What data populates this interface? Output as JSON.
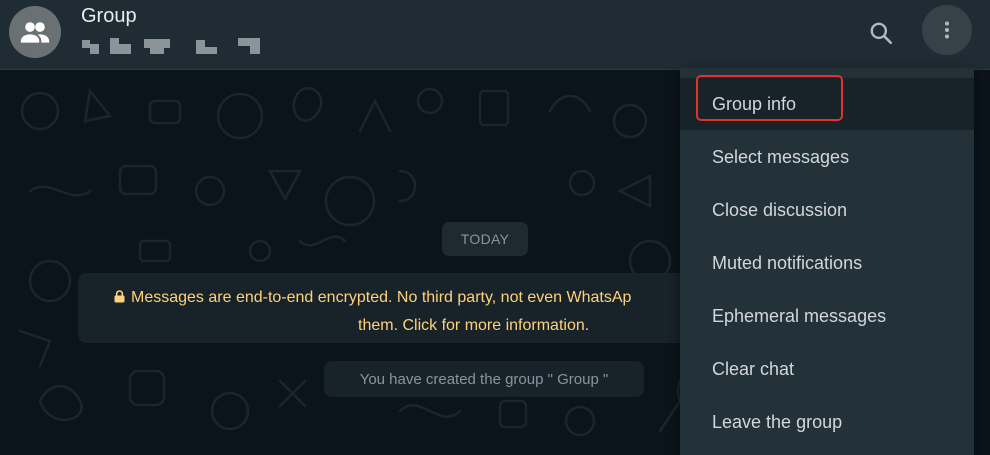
{
  "header": {
    "title": "Group",
    "avatar_icon": "group-icon",
    "search_icon": "search-icon",
    "menu_icon": "more-vertical-icon"
  },
  "chat": {
    "date_divider": "TODAY",
    "encryption_notice": {
      "icon": "lock-icon",
      "line1": "Messages are end-to-end encrypted. No third party, not even WhatsAp",
      "line2": "them. Click for more information."
    },
    "system_message": "You have created the group \" Group \""
  },
  "menu": {
    "items": [
      {
        "label": "Group info",
        "highlighted": true
      },
      {
        "label": "Select messages"
      },
      {
        "label": "Close discussion"
      },
      {
        "label": "Muted notifications"
      },
      {
        "label": "Ephemeral messages"
      },
      {
        "label": "Clear chat"
      },
      {
        "label": "Leave the group"
      }
    ]
  },
  "colors": {
    "header_bg": "#202c33",
    "chat_bg": "#0b141a",
    "menu_bg": "#233138",
    "notice_text": "#ffd279",
    "highlight": "#e1322e"
  }
}
